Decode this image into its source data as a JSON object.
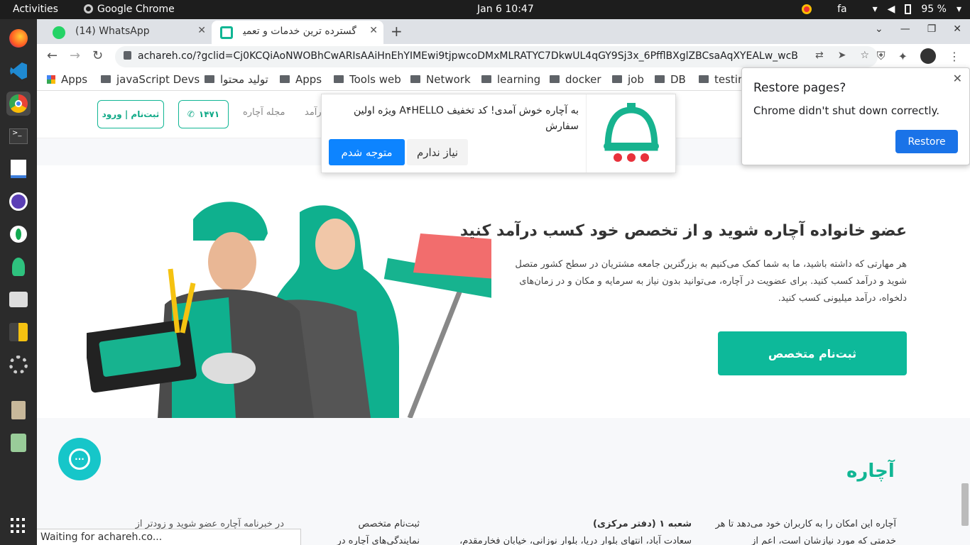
{
  "topbar": {
    "activities": "Activities",
    "app_name": "Google Chrome",
    "clock": "Jan 6  10:47",
    "lang": "fa",
    "battery": "95 %"
  },
  "tabs": [
    {
      "label": "(14) WhatsApp",
      "badge": "14"
    },
    {
      "label": "گسترده ترین خدمات و تعمیرا"
    }
  ],
  "omnibox": {
    "url": "achareh.co/?gclid=Cj0KCQiAoNWOBhCwARIsAAiHnEhYIMEwi9tjpwcoDMxMLRATYC7DkwUL4qGY9Sj3x_6PfflBXglZBCsaAqXYEALw_wcB"
  },
  "bookmarks": [
    "Apps",
    "javaScript Devs",
    "تولید محتوا",
    "Apps",
    "Tools web",
    "Network",
    "learning",
    "docker",
    "job",
    "DB",
    "testin"
  ],
  "site": {
    "login_button": "ثبت‌نام | ورود",
    "phone_button": "۱۴۷۱",
    "nav_magazine": "مجله آچاره",
    "nav_income": "درآمد",
    "hero_title": "عضو خانواده آچاره شوید و از تخصص خود کسب درآمد کنید",
    "hero_text": "هر مهارتی که داشته باشید، ما به شما کمک می‌کنیم به بزرگترین جامعه مشتریان در سطح کشور متصل شوید و درآمد کسب کنید. برای عضویت در آچاره، می‌توانید بدون نیاز به سرمایه و مکان و در زمان‌های دلخواه، درآمد میلیونی کسب کنید.",
    "hero_cta": "ثبت‌نام متخصص",
    "logo": "آچاره",
    "footer_about": "آچاره این امکان را به کاربران خود می‌دهد تا هر خدمتی که مورد نیازشان است، اعم از",
    "footer_branch_title": "شعبه ۱ (دفتر مرکزی)",
    "footer_branch_text": "سعادت آباد، انتهای بلوار دریا، بلوار نوزانی، خیابان فخارمقدم،",
    "footer_signup_title": "ثبت‌نام متخصص",
    "footer_signup_text": "نمایندگی‌های آچاره در",
    "footer_newsletter": "در خبرنامه آچاره عضو شوید و زودتر از"
  },
  "welcome_popup": {
    "message": "به آچاره خوش آمدی! کد تخفیف A۴HELLO ویژه اولین سفارش",
    "ok": "متوجه شدم",
    "no": "نیاز ندارم"
  },
  "restore_dialog": {
    "title": "Restore pages?",
    "body": "Chrome didn't shut down correctly.",
    "button": "Restore"
  },
  "status": "Waiting for achareh.co..."
}
